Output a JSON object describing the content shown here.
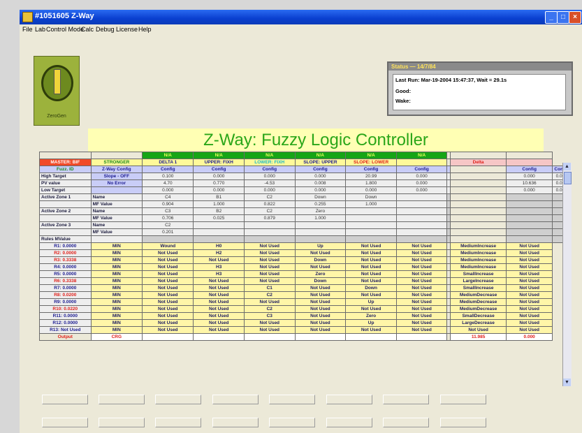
{
  "window": {
    "title": "#1051605 Z-Way",
    "buttons": {
      "minimize": "_",
      "maximize": "□",
      "close": "×"
    }
  },
  "menu": [
    "File",
    "Lab",
    "Control Mode",
    "Calc",
    "Debug",
    "License",
    "Help"
  ],
  "logo": {
    "label": "ZeroGen"
  },
  "status": {
    "header": "Status — 14/7/84",
    "last_run": "Last Run:   Mar-19-2004 15:47:37,  Wait = 29.1s",
    "good_label": "Good:",
    "wake_label": "Wake:"
  },
  "banner_title": "Z-Way: Fuzzy Logic Controller",
  "grid": {
    "na_label": "N/A",
    "col_headers": [
      {
        "text": "MASTER: BIF",
        "cls": "hdr-orange"
      },
      {
        "text": "STRONGER",
        "cls": "hdr-yel",
        "color": "#1a8a1a"
      },
      {
        "text": "DELTA 1",
        "cls": "hdr-yel",
        "color": "#1a1a90"
      },
      {
        "text": "UPPER: FIXH",
        "cls": "hdr-yel",
        "color": "#1a1a90"
      },
      {
        "text": "LOWER: FIXH",
        "cls": "hdr-yel",
        "color": "#19b8c8"
      },
      {
        "text": "SLOPE: UPPER",
        "cls": "hdr-yel",
        "color": "#1a1a90"
      },
      {
        "text": "SLOPE: LOWER",
        "cls": "hdr-yel",
        "color": "#e0201a"
      },
      {
        "text": "",
        "cls": "hdr-yel"
      },
      {
        "text": "",
        "cls": "hole"
      },
      {
        "text": "Delta",
        "cls": "hdr-yel",
        "color": "#e0201a",
        "bg": "#f6c6c6"
      },
      {
        "text": "",
        "cls": "hdr-yel",
        "bg": "#f6c6c6"
      }
    ],
    "config_row": {
      "label": "Fuzz. ID",
      "cells": [
        "Z-Way Config",
        "Config",
        "Config",
        "Config",
        "Config",
        "Config",
        "Config",
        "",
        "Config",
        "Config"
      ]
    },
    "value_rows": [
      {
        "label": "High Target",
        "cells": [
          "Slope - OFF",
          "0.100",
          "0.000",
          "0.000",
          "0.000",
          "20.99",
          "0.000",
          "",
          "0.000",
          "0.000"
        ]
      },
      {
        "label": "PV value",
        "cells": [
          "No Error",
          "4.70",
          "0.770",
          "-4.53",
          "0.008",
          "1.800",
          "0.000",
          "",
          "10.636",
          "0.000"
        ]
      },
      {
        "label": "Low Target",
        "cells": [
          "",
          "0.000",
          "0.000",
          "0.000",
          "0.000",
          "0.000",
          "0.000",
          "",
          "0.000",
          "0.000"
        ]
      }
    ],
    "zone_rows": [
      {
        "label": "Active Zone 1",
        "sub": "Name",
        "cells": [
          "C4",
          "B1",
          "C2",
          "Down",
          "Down",
          "",
          "",
          "",
          ""
        ]
      },
      {
        "label": "",
        "sub": "MF Value",
        "cells": [
          "0.904",
          "1.000",
          "0.822",
          "0.255",
          "1.000",
          "",
          "",
          "",
          ""
        ]
      },
      {
        "label": "Active Zone 2",
        "sub": "Name",
        "cells": [
          "C3",
          "B2",
          "C2",
          "Zero",
          "",
          "",
          "",
          "",
          ""
        ]
      },
      {
        "label": "",
        "sub": "MF Value",
        "cells": [
          "0.706",
          "0.025",
          "0.879",
          "1.000",
          "",
          "",
          "",
          "",
          ""
        ]
      },
      {
        "label": "Active Zone 3",
        "sub": "Name",
        "cells": [
          "C2",
          "",
          "",
          "",
          "",
          "",
          "",
          "",
          ""
        ]
      },
      {
        "label": "",
        "sub": "MF Value",
        "cells": [
          "0.201",
          "",
          "",
          "",
          "",
          "",
          "",
          "",
          ""
        ]
      },
      {
        "label": "Rules MValue",
        "sub": "",
        "cells": [
          "",
          "",
          "",
          "",
          "",
          "",
          "",
          "",
          ""
        ]
      }
    ],
    "rule_rows": [
      {
        "label": "R1: 0.0000",
        "red": false,
        "cells": [
          "MIN",
          "Wound",
          "H0",
          "Not Used",
          "Up",
          "Not Used",
          "Not Used",
          "MediumIncrease",
          "Not Used"
        ]
      },
      {
        "label": "R2: 0.0000",
        "red": true,
        "cells": [
          "MIN",
          "Not Used",
          "H2",
          "Not Used",
          "Not Used",
          "Not Used",
          "Not Used",
          "MediumIncrease",
          "Not Used"
        ]
      },
      {
        "label": "R3: 0.3338",
        "red": true,
        "cells": [
          "MIN",
          "Not Used",
          "Not Used",
          "Not Used",
          "Down",
          "Not Used",
          "Not Used",
          "MediumIncrease",
          "Not Used"
        ]
      },
      {
        "label": "R4: 0.0000",
        "red": false,
        "cells": [
          "MIN",
          "Not Used",
          "H3",
          "Not Used",
          "Not Used",
          "Not Used",
          "Not Used",
          "MediumIncrease",
          "Not Used"
        ]
      },
      {
        "label": "R5: 0.0000",
        "red": false,
        "cells": [
          "MIN",
          "Not Used",
          "H3",
          "Not Used",
          "Zero",
          "Not Used",
          "Not Used",
          "SmallIncrease",
          "Not Used"
        ]
      },
      {
        "label": "R6: 0.3338",
        "red": true,
        "cells": [
          "MIN",
          "Not Used",
          "Not Used",
          "Not Used",
          "Down",
          "Not Used",
          "Not Used",
          "LargeIncrease",
          "Not Used"
        ]
      },
      {
        "label": "R7: 0.0000",
        "red": false,
        "cells": [
          "MIN",
          "Not Used",
          "Not Used",
          "C1",
          "Not Used",
          "Down",
          "Not Used",
          "SmallIncrease",
          "Not Used"
        ]
      },
      {
        "label": "R8: 0.0200",
        "red": true,
        "cells": [
          "MIN",
          "Not Used",
          "Not Used",
          "C2",
          "Not Used",
          "Not Used",
          "Not Used",
          "MediumDecrease",
          "Not Used"
        ]
      },
      {
        "label": "R9: 0.0000",
        "red": false,
        "cells": [
          "MIN",
          "Not Used",
          "Not Used",
          "Not Used",
          "Not Used",
          "Up",
          "Not Used",
          "MediumDecrease",
          "Not Used"
        ]
      },
      {
        "label": "R10: 0.0220",
        "red": true,
        "cells": [
          "MIN",
          "Not Used",
          "Not Used",
          "C2",
          "Not Used",
          "Not Used",
          "Not Used",
          "MediumDecrease",
          "Not Used"
        ]
      },
      {
        "label": "R11: 0.0000",
        "red": false,
        "cells": [
          "MIN",
          "Not Used",
          "Not Used",
          "C3",
          "Not Used",
          "Zero",
          "Not Used",
          "SmallDecrease",
          "Not Used"
        ]
      },
      {
        "label": "R12: 0.0000",
        "red": false,
        "cells": [
          "MIN",
          "Not Used",
          "Not Used",
          "Not Used",
          "Not Used",
          "Up",
          "Not Used",
          "LargeDecrease",
          "Not Used"
        ]
      },
      {
        "label": "R13: Not Used",
        "red": false,
        "cells": [
          "MIN",
          "Not Used",
          "Not Used",
          "Not Used",
          "Not Used",
          "Not Used",
          "Not Used",
          "Not Used",
          "Not Used"
        ]
      }
    ],
    "output_row": {
      "label": "Output",
      "cells": [
        "CRG",
        "",
        "",
        "",
        "",
        "",
        "",
        "11.985",
        "0.000"
      ]
    }
  }
}
